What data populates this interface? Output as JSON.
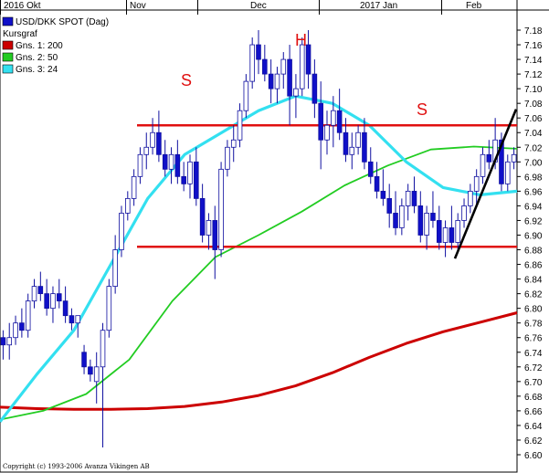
{
  "chart_data": {
    "type": "candlestick",
    "title": "USD/DKK SPOT (Dag)",
    "subtitle": "Kursgraf",
    "x_labels": [
      "2016 Okt",
      "Nov",
      "Dec",
      "2017 Jan",
      "Feb"
    ],
    "ylim": [
      6.58,
      7.2
    ],
    "y_ticks": [
      "7.18",
      "7.16",
      "7.14",
      "7.12",
      "7.10",
      "7.08",
      "7.06",
      "7.04",
      "7.02",
      "7.00",
      "6.98",
      "6.96",
      "6.94",
      "6.92",
      "6.90",
      "6.88",
      "6.86",
      "6.84",
      "6.82",
      "6.80",
      "6.78",
      "6.76",
      "6.74",
      "6.72",
      "6.70",
      "6.68",
      "6.66",
      "6.64",
      "6.62",
      "6.60"
    ],
    "legend": [
      {
        "name": "USD/DKK SPOT (Dag)",
        "color": "#1010c8"
      },
      {
        "name": "Kursgraf",
        "color": ""
      },
      {
        "name": "Gns. 1: 200",
        "color": "#cc0000"
      },
      {
        "name": "Gns. 2: 50",
        "color": "#22cc22"
      },
      {
        "name": "Gns. 3: 24",
        "color": "#33e0f0"
      }
    ],
    "annotations": [
      "S",
      "H",
      "S"
    ],
    "resistance_level": 7.05,
    "support_level": 6.884,
    "trendline": [
      [
        6.87,
        7.07
      ]
    ],
    "candles": [
      [
        6.76,
        6.77,
        6.73,
        6.75
      ],
      [
        6.75,
        6.78,
        6.73,
        6.76
      ],
      [
        6.76,
        6.79,
        6.75,
        6.78
      ],
      [
        6.78,
        6.8,
        6.76,
        6.77
      ],
      [
        6.77,
        6.82,
        6.76,
        6.81
      ],
      [
        6.81,
        6.84,
        6.8,
        6.83
      ],
      [
        6.83,
        6.85,
        6.81,
        6.82
      ],
      [
        6.82,
        6.84,
        6.79,
        6.8
      ],
      [
        6.8,
        6.83,
        6.78,
        6.82
      ],
      [
        6.82,
        6.84,
        6.8,
        6.81
      ],
      [
        6.81,
        6.83,
        6.78,
        6.79
      ],
      [
        6.79,
        6.8,
        6.77,
        6.78
      ],
      [
        6.78,
        6.79,
        6.76,
        6.79
      ],
      [
        6.74,
        6.75,
        6.71,
        6.72
      ],
      [
        6.72,
        6.73,
        6.7,
        6.71
      ],
      [
        6.7,
        6.74,
        6.67,
        6.72
      ],
      [
        6.72,
        6.78,
        6.61,
        6.77
      ],
      [
        6.77,
        6.84,
        6.76,
        6.83
      ],
      [
        6.83,
        6.9,
        6.82,
        6.88
      ],
      [
        6.88,
        6.94,
        6.87,
        6.93
      ],
      [
        6.93,
        6.96,
        6.92,
        6.95
      ],
      [
        6.95,
        6.99,
        6.94,
        6.98
      ],
      [
        6.98,
        7.02,
        6.97,
        7.01
      ],
      [
        7.01,
        7.04,
        6.99,
        7.02
      ],
      [
        7.02,
        7.06,
        7.01,
        7.04
      ],
      [
        7.04,
        7.07,
        7.0,
        7.01
      ],
      [
        7.01,
        7.03,
        6.98,
        6.99
      ],
      [
        6.99,
        7.02,
        6.97,
        7.01
      ],
      [
        7.01,
        7.03,
        6.97,
        6.98
      ],
      [
        6.98,
        7.0,
        6.96,
        6.97
      ],
      [
        6.97,
        7.01,
        6.95,
        7.0
      ],
      [
        7.0,
        7.02,
        6.94,
        6.95
      ],
      [
        6.95,
        6.97,
        6.89,
        6.9
      ],
      [
        6.9,
        6.93,
        6.88,
        6.92
      ],
      [
        6.92,
        6.94,
        6.84,
        6.88
      ],
      [
        6.88,
        7.0,
        6.87,
        6.99
      ],
      [
        6.99,
        7.03,
        6.98,
        7.02
      ],
      [
        7.02,
        7.05,
        7.0,
        7.03
      ],
      [
        7.03,
        7.08,
        7.02,
        7.07
      ],
      [
        7.07,
        7.12,
        7.06,
        7.11
      ],
      [
        7.11,
        7.17,
        7.1,
        7.16
      ],
      [
        7.16,
        7.18,
        7.12,
        7.14
      ],
      [
        7.14,
        7.16,
        7.11,
        7.12
      ],
      [
        7.12,
        7.14,
        7.08,
        7.1
      ],
      [
        7.1,
        7.13,
        7.08,
        7.12
      ],
      [
        7.12,
        7.15,
        7.1,
        7.14
      ],
      [
        7.14,
        7.16,
        7.05,
        7.09
      ],
      [
        7.09,
        7.12,
        7.06,
        7.1
      ],
      [
        7.1,
        7.17,
        7.09,
        7.16
      ],
      [
        7.16,
        7.18,
        7.1,
        7.12
      ],
      [
        7.12,
        7.14,
        7.06,
        7.08
      ],
      [
        7.08,
        7.11,
        6.99,
        7.03
      ],
      [
        7.03,
        7.07,
        7.01,
        7.05
      ],
      [
        7.05,
        7.09,
        7.02,
        7.07
      ],
      [
        7.07,
        7.1,
        7.03,
        7.04
      ],
      [
        7.04,
        7.06,
        7.0,
        7.01
      ],
      [
        7.01,
        7.04,
        6.99,
        7.02
      ],
      [
        7.02,
        7.05,
        7.01,
        7.04
      ],
      [
        7.04,
        7.06,
        6.99,
        7.0
      ],
      [
        7.0,
        7.02,
        6.97,
        6.98
      ],
      [
        6.98,
        7.0,
        6.95,
        6.96
      ],
      [
        6.96,
        6.99,
        6.94,
        6.95
      ],
      [
        6.95,
        6.97,
        6.91,
        6.93
      ],
      [
        6.93,
        6.96,
        6.9,
        6.91
      ],
      [
        6.91,
        6.95,
        6.9,
        6.94
      ],
      [
        6.94,
        6.97,
        6.92,
        6.96
      ],
      [
        6.96,
        6.98,
        6.93,
        6.94
      ],
      [
        6.94,
        6.96,
        6.89,
        6.9
      ],
      [
        6.9,
        6.94,
        6.88,
        6.93
      ],
      [
        6.93,
        6.96,
        6.91,
        6.92
      ],
      [
        6.92,
        6.94,
        6.88,
        6.89
      ],
      [
        6.89,
        6.92,
        6.87,
        6.91
      ],
      [
        6.91,
        6.94,
        6.88,
        6.89
      ],
      [
        6.89,
        6.93,
        6.88,
        6.92
      ],
      [
        6.92,
        6.95,
        6.91,
        6.94
      ],
      [
        6.94,
        6.97,
        6.93,
        6.96
      ],
      [
        6.96,
        6.99,
        6.94,
        6.98
      ],
      [
        6.98,
        7.02,
        6.97,
        7.01
      ],
      [
        7.01,
        7.03,
        6.99,
        7.0
      ],
      [
        7.0,
        7.06,
        6.99,
        7.03
      ],
      [
        7.03,
        7.04,
        6.96,
        6.97
      ],
      [
        6.97,
        7.01,
        6.96,
        7.0
      ],
      [
        7.0,
        7.02,
        6.99,
        7.01
      ]
    ],
    "ma200": [
      6.665,
      6.663,
      6.662,
      6.662,
      6.663,
      6.666,
      6.672,
      6.681,
      6.694,
      6.712,
      6.733,
      6.752,
      6.768,
      6.781,
      6.794
    ],
    "ma50": [
      6.648,
      6.66,
      6.683,
      6.73,
      6.81,
      6.87,
      6.9,
      6.932,
      6.968,
      6.995,
      7.017,
      7.021,
      7.018
    ],
    "ma24": [
      6.645,
      6.71,
      6.77,
      6.86,
      6.95,
      7.01,
      7.04,
      7.07,
      7.09,
      7.08,
      7.05,
      7.0,
      6.965,
      6.955,
      6.96
    ]
  },
  "copyright": "Copyright (c) 1993-2006 Avanza Vikingen AB"
}
